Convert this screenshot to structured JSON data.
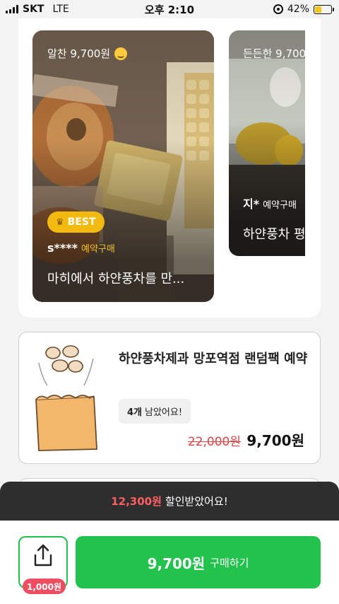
{
  "status": {
    "carrier": "SKT",
    "network": "LTE",
    "time": "오후 2:10",
    "battery": "42%",
    "battery_level": 0.42
  },
  "reviews": [
    {
      "price": "알찬 9,700원",
      "badge": "BEST",
      "user": "s****",
      "tag": "예약구매",
      "title": "마히에서 하얀풍차를 만..."
    },
    {
      "price": "든든한 9,700",
      "user": "지*",
      "tag": "예약구매",
      "title": "하얀풍차 평"
    }
  ],
  "product": {
    "title": "하얀풍차제과 망포역점 랜덤팩 예약",
    "stock_count": "4개",
    "stock_text": "남았어요!",
    "original_price": "22,000원",
    "price": "9,700원"
  },
  "bottom": {
    "discount_amount": "12,300원",
    "discount_text": "할인받았어요!",
    "share_reward": "1,000원",
    "buy_price": "9,700원",
    "buy_label": "구매하기"
  },
  "colors": {
    "accent": "#22c24d",
    "discount": "#ff5f5f",
    "best_badge": "#f2b90f",
    "reward": "#ef4e62"
  },
  "icons": [
    "signal-icon",
    "rotation-lock-icon",
    "battery-icon",
    "smile-emoji-icon",
    "crown-icon",
    "share-icon",
    "bread-bag-illustration"
  ]
}
